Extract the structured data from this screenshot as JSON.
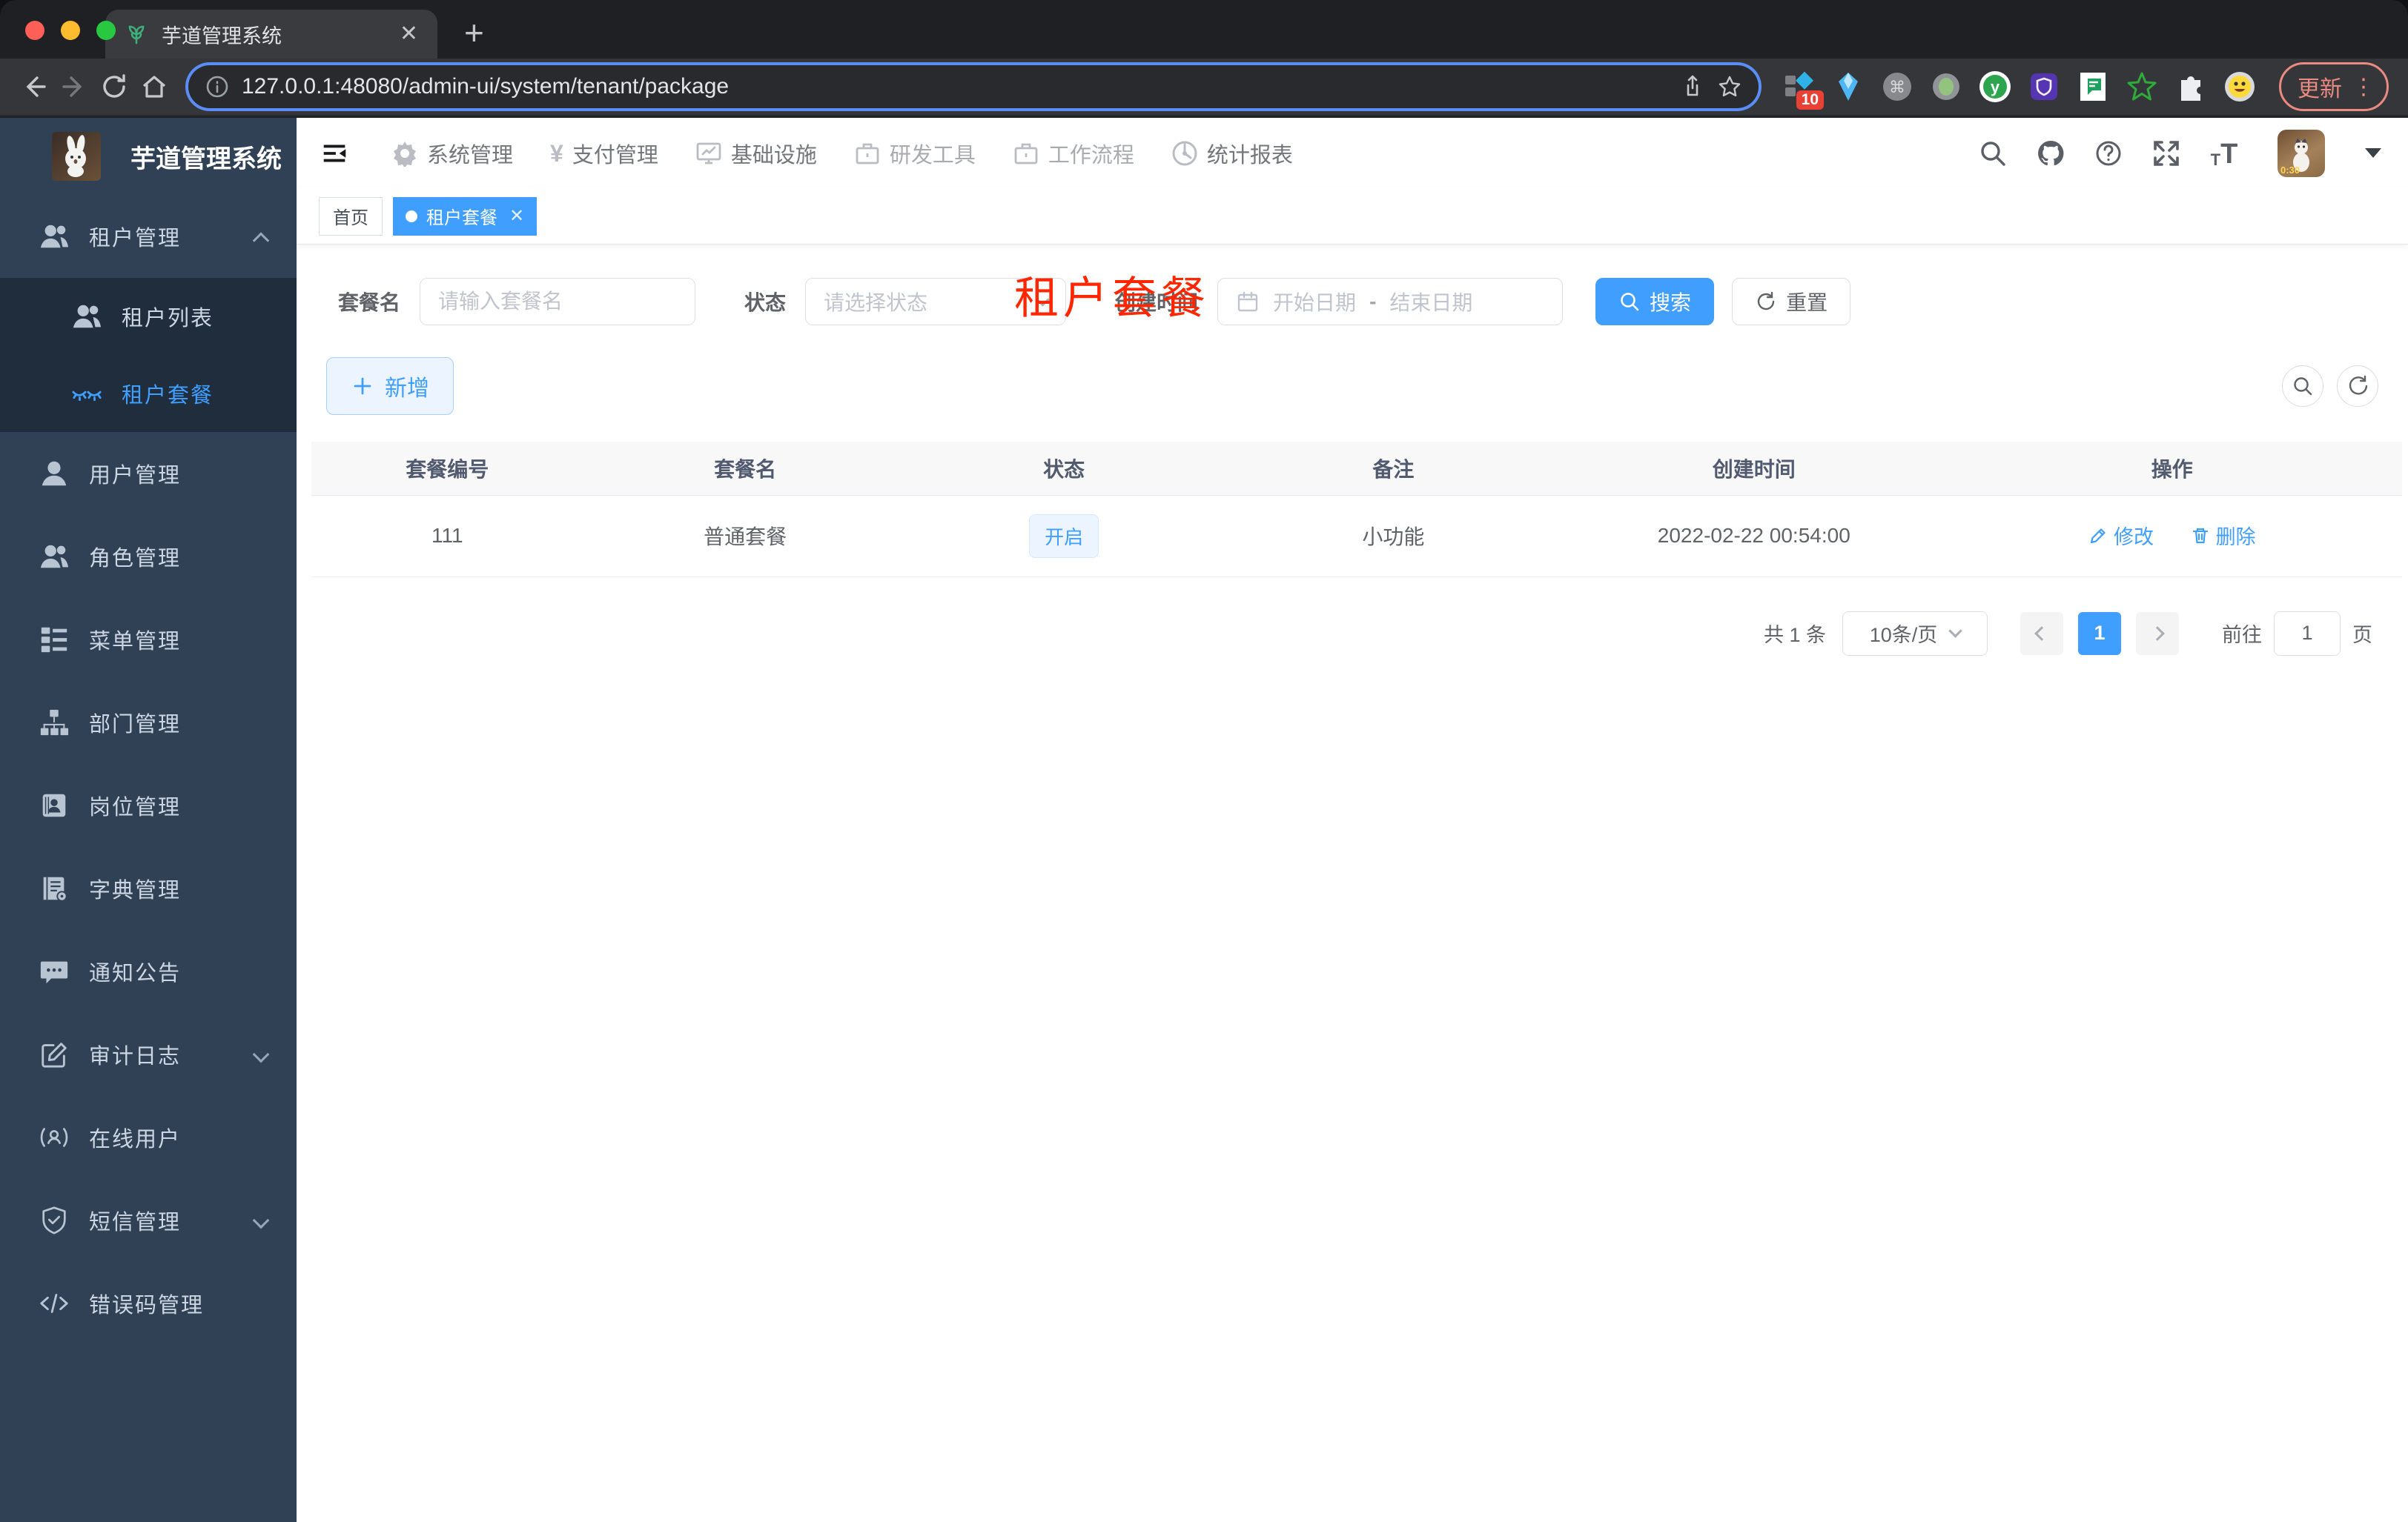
{
  "browser": {
    "tab_title": "芋道管理系统",
    "url": "127.0.0.1:48080/admin-ui/system/tenant/package",
    "update_label": "更新",
    "extension_badge": "10",
    "avatar_time": "0:30"
  },
  "header": {
    "nav": [
      {
        "label": "系统管理"
      },
      {
        "label": "支付管理"
      },
      {
        "label": "基础设施"
      },
      {
        "label": "研发工具"
      },
      {
        "label": "工作流程"
      },
      {
        "label": "统计报表"
      }
    ]
  },
  "sidebar": {
    "title": "芋道管理系统",
    "items": [
      {
        "label": "租户管理"
      },
      {
        "label": "租户列表"
      },
      {
        "label": "租户套餐"
      },
      {
        "label": "用户管理"
      },
      {
        "label": "角色管理"
      },
      {
        "label": "菜单管理"
      },
      {
        "label": "部门管理"
      },
      {
        "label": "岗位管理"
      },
      {
        "label": "字典管理"
      },
      {
        "label": "通知公告"
      },
      {
        "label": "审计日志"
      },
      {
        "label": "在线用户"
      },
      {
        "label": "短信管理"
      },
      {
        "label": "错误码管理"
      }
    ]
  },
  "tags": {
    "home": "首页",
    "active": "租户套餐"
  },
  "page_title": "租户套餐",
  "filters": {
    "name_label": "套餐名",
    "name_placeholder": "请输入套餐名",
    "status_label": "状态",
    "status_placeholder": "请选择状态",
    "date_label": "创建时间",
    "date_start_placeholder": "开始日期",
    "date_separator": "-",
    "date_end_placeholder": "结束日期",
    "search_label": "搜索",
    "reset_label": "重置"
  },
  "toolbar": {
    "add_label": "新增"
  },
  "table": {
    "columns": [
      "套餐编号",
      "套餐名",
      "状态",
      "备注",
      "创建时间",
      "操作"
    ],
    "rows": [
      {
        "id": "111",
        "name": "普通套餐",
        "status": "开启",
        "remark": "小功能",
        "created": "2022-02-22 00:54:00",
        "edit_label": "修改",
        "delete_label": "删除"
      }
    ]
  },
  "pagination": {
    "total": "共 1 条",
    "page_size": "10条/页",
    "page": "1",
    "goto_label": "前往",
    "goto_value": "1",
    "unit": "页"
  },
  "colors": {
    "accent": "#409eff",
    "red_title": "#ff2600",
    "sidebar_bg": "#304156",
    "submenu_bg": "#1f2d3d",
    "status_tag_bg": "#ecf5ff"
  }
}
